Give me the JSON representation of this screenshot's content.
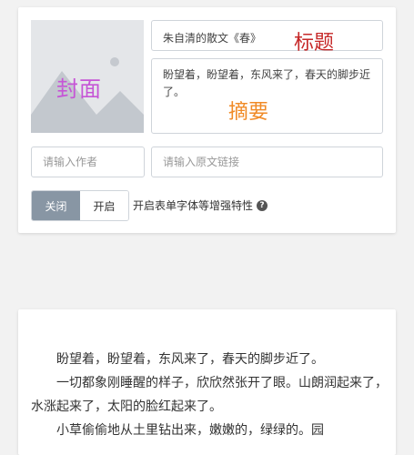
{
  "editor": {
    "cover_label": "封面",
    "title_value": "朱自清的散文《春》",
    "title_label": "标题",
    "summary_value": "盼望着，盼望着，东风来了，春天的脚步近了。",
    "summary_label": "摘要",
    "author_placeholder": "请输入作者",
    "link_placeholder": "请输入原文链接",
    "toggle": {
      "off_label": "关闭",
      "on_label": "开启",
      "selected": "off"
    },
    "enhance_label": "开启表单字体等增强特性",
    "help_icon": "question-circle-icon"
  },
  "article": {
    "paragraphs": [
      "盼望着，盼望着，东风来了，春天的脚步近了。",
      "一切都象刚睡醒的样子，欣欣然张开了眼。山朗润起来了，水涨起来了，太阳的脸红起来了。",
      "小草偷偷地从土里钻出来，嫩嫩的，绿绿的。园"
    ]
  },
  "colors": {
    "cover_label": "#c655d6",
    "title_label": "#c62828",
    "summary_label": "#f08a26",
    "toggle_active": "#8896a4"
  }
}
